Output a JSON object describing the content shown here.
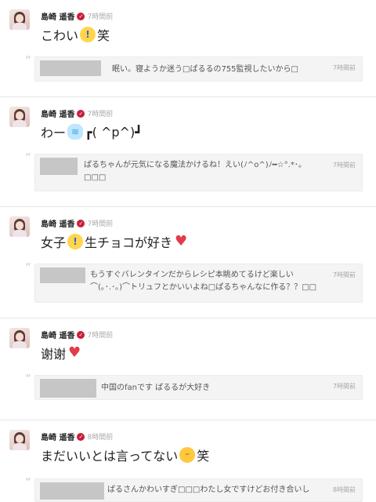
{
  "user": {
    "name": "島崎 遥香",
    "verified_icon": "verified-check-icon"
  },
  "posts": [
    {
      "time": "7時間前",
      "message_parts": [
        "こわい",
        "笑"
      ],
      "emoji": [
        "face-screaming-icon"
      ],
      "reply": {
        "text": "眠い。寝ようか迷う□ぱるるの755監視したいから□",
        "time": "7時間前"
      }
    },
    {
      "time": "7時間前",
      "message_parts": [
        "わー",
        "┏( ^p^)┛"
      ],
      "emoji": [
        "dash-icon"
      ],
      "reply": {
        "text": "ぱるちゃんが元気になる魔法かけるね！えい(ﾉ^o^)ﾉ━☆°.*･。□□□",
        "time": "7時間前"
      }
    },
    {
      "time": "7時間前",
      "message_parts": [
        "女子",
        "生チョコが好き"
      ],
      "emoji": [
        "face-screaming-icon",
        "heart-icon"
      ],
      "reply": {
        "text": "もうすぐバレンタインだからレシピ本眺めてるけど楽しい⌒(｡･.･｡)⌒トリュフとかいいよね□ぱるちゃんなに作る？？□□",
        "time": "7時間前"
      }
    },
    {
      "time": "7時間前",
      "message_parts": [
        "谢谢"
      ],
      "emoji": [
        "heart-icon"
      ],
      "reply": {
        "text": "中国のfanです ぱるるが大好き",
        "time": "7時間前"
      }
    },
    {
      "time": "8時間前",
      "message_parts": [
        "まだいいとは言ってない",
        "笑"
      ],
      "emoji": [
        "face-laughing-icon"
      ],
      "reply": {
        "text": "ぱるさんかわいすぎ□□□わたし女ですけどお付き合いし",
        "time": "8時間前"
      }
    }
  ],
  "colors": {
    "verified": "#c81e3a",
    "heart": "#e23b4a",
    "reply_bg": "#f4f4f4"
  }
}
